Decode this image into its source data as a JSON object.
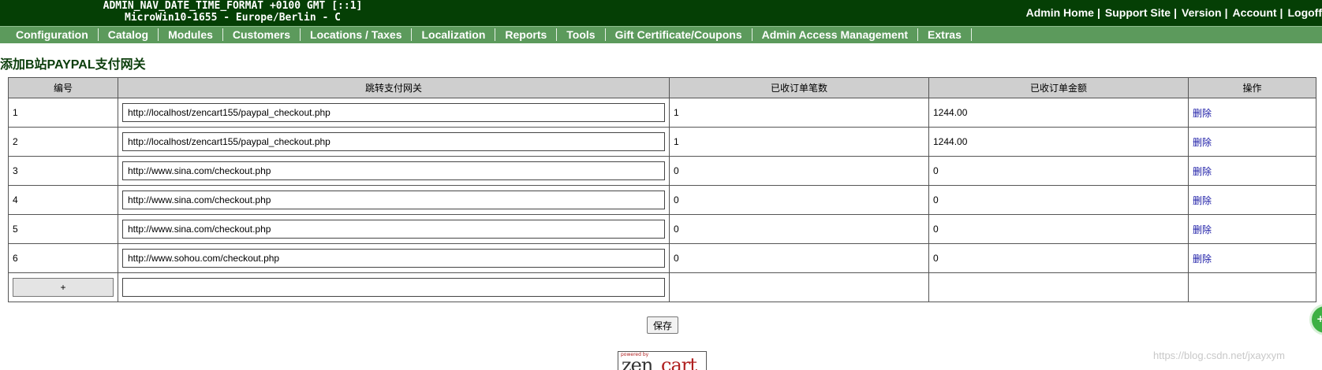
{
  "header": {
    "info_line1": "ADMIN_NAV_DATE_TIME_FORMAT +0100 GMT [::1]",
    "info_line2": "MicroWin10-1655 - Europe/Berlin - C",
    "links": [
      "Admin Home",
      "Support Site",
      "Version",
      "Account",
      "Logoff"
    ],
    "separator": "|"
  },
  "nav": {
    "items": [
      "Configuration",
      "Catalog",
      "Modules",
      "Customers",
      "Locations / Taxes",
      "Localization",
      "Reports",
      "Tools",
      "Gift Certificate/Coupons",
      "Admin Access Management",
      "Extras"
    ]
  },
  "page": {
    "title": "添加B站PAYPAL支付网关"
  },
  "table": {
    "headers": [
      "编号",
      "跳转支付网关",
      "已收订单笔数",
      "已收订单金额",
      "操作"
    ],
    "rows": [
      {
        "id": "1",
        "url": "http://localhost/zencart155/paypal_checkout.php",
        "count": "1",
        "amount": "1244.00",
        "action": "删除"
      },
      {
        "id": "2",
        "url": "http://localhost/zencart155/paypal_checkout.php",
        "count": "1",
        "amount": "1244.00",
        "action": "删除"
      },
      {
        "id": "3",
        "url": "http://www.sina.com/checkout.php",
        "count": "0",
        "amount": "0",
        "action": "删除"
      },
      {
        "id": "4",
        "url": "http://www.sina.com/checkout.php",
        "count": "0",
        "amount": "0",
        "action": "删除"
      },
      {
        "id": "5",
        "url": "http://www.sina.com/checkout.php",
        "count": "0",
        "amount": "0",
        "action": "删除"
      },
      {
        "id": "6",
        "url": "http://www.sohou.com/checkout.php",
        "count": "0",
        "amount": "0",
        "action": "删除"
      }
    ],
    "add_button": "+",
    "new_url_value": ""
  },
  "footer": {
    "save_label": "保存",
    "logo_powered": "powered by",
    "logo_zen": "zen",
    "logo_cart": "cart",
    "watermark": "https://blog.csdn.net/jxayxym",
    "float_label": "+"
  },
  "colors": {
    "topbar": "#053f05",
    "navbar": "#5c9a5c",
    "title": "#0b3d0b",
    "link": "#1a1aa6",
    "header_cell": "#cfcfcf"
  }
}
